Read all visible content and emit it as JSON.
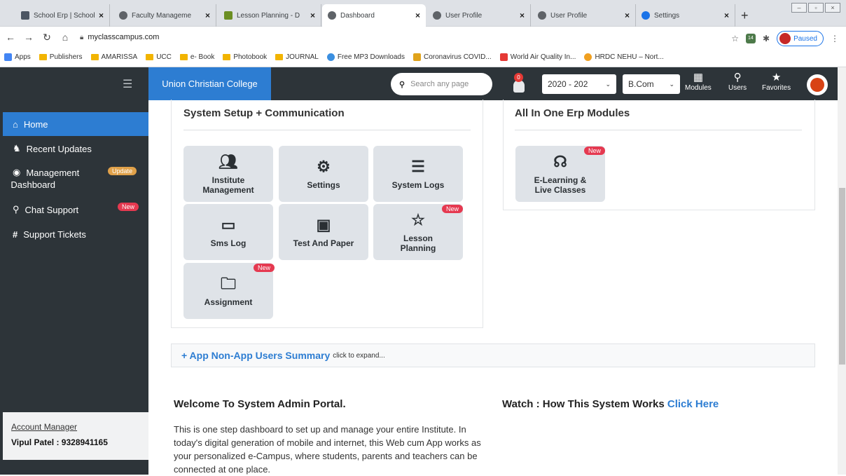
{
  "browser": {
    "tabs": [
      {
        "label": "School Erp | School"
      },
      {
        "label": "Faculty Manageme"
      },
      {
        "label": "Lesson Planning - D"
      },
      {
        "label": "Dashboard"
      },
      {
        "label": "User Profile"
      },
      {
        "label": "User Profile"
      },
      {
        "label": "Settings"
      }
    ],
    "url": "myclasscampus.com",
    "profile_status": "Paused",
    "extension_badge": "14",
    "bookmarks": [
      {
        "label": "Apps"
      },
      {
        "label": "Publishers"
      },
      {
        "label": "AMARISSA"
      },
      {
        "label": "UCC"
      },
      {
        "label": "e- Book"
      },
      {
        "label": "Photobook"
      },
      {
        "label": "JOURNAL"
      },
      {
        "label": "Free MP3 Downloads"
      },
      {
        "label": "Coronavirus COVID..."
      },
      {
        "label": "World Air Quality In..."
      },
      {
        "label": "HRDC NEHU – Nort..."
      }
    ]
  },
  "header": {
    "college": "Union Christian College",
    "search_placeholder": "Search any page",
    "notification_count": "0",
    "year": "2020 - 202",
    "course": "B.Com",
    "buttons": [
      "Modules",
      "Users",
      "Favorites"
    ]
  },
  "sidebar": {
    "items": [
      {
        "label": "Home"
      },
      {
        "label": "Recent Updates"
      },
      {
        "label": "Management Dashboard",
        "badge": "Update"
      },
      {
        "label": "Chat Support",
        "badge": "New"
      },
      {
        "label": "Support Tickets"
      }
    ],
    "account_label": "Account Manager",
    "account_value": "Vipul Patel : 9328941165"
  },
  "system_setup": {
    "title": "System Setup + Communication",
    "tiles": [
      {
        "label": "Institute Management"
      },
      {
        "label": "Settings"
      },
      {
        "label": "System Logs"
      },
      {
        "label": "Sms Log"
      },
      {
        "label": "Test And Paper"
      },
      {
        "label": "Lesson Planning",
        "badge": "New"
      },
      {
        "label": "Assignment",
        "badge": "New"
      }
    ]
  },
  "erp_modules": {
    "title": "All In One Erp Modules",
    "tiles": [
      {
        "label": "E-Learning & Live Classes",
        "badge": "New"
      }
    ]
  },
  "summary": {
    "title": "+ App Non-App Users Summary",
    "hint": "click to expand..."
  },
  "welcome": {
    "title": "Welcome To System Admin Portal.",
    "text": "This is one step dashboard to set up and manage your entire Institute. In today's digital generation of mobile and internet, this Web cum App works as your personalized e-Campus, where students, parents and teachers can be connected at one place."
  },
  "watch": {
    "title": "Watch : How This System Works",
    "link": "Click Here"
  }
}
